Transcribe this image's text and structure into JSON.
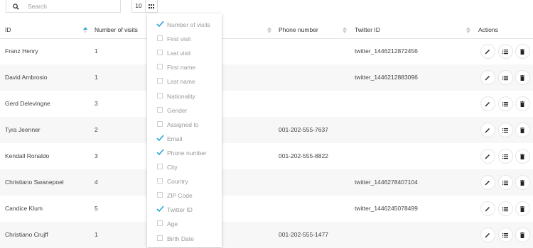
{
  "search": {
    "placeholder": "Search"
  },
  "page_size": "10",
  "table": {
    "columns": {
      "id": "ID",
      "visits": "Number of visits",
      "phone": "Phone number",
      "twitter": "Twitter ID",
      "actions": "Actions"
    },
    "rows": [
      {
        "id": "Franz Henry",
        "visits": "1",
        "phone": "",
        "twitter": "twitter_1446212872456"
      },
      {
        "id": "David Ambrosio",
        "visits": "1",
        "phone": "",
        "twitter": "twitter_1446212883096"
      },
      {
        "id": "Gerd Delevingne",
        "visits": "3",
        "phone": "",
        "twitter": ""
      },
      {
        "id": "Tyra Jeenner",
        "visits": "2",
        "phone": "001-202-555-7637",
        "twitter": ""
      },
      {
        "id": "Kendall Ronaldo",
        "visits": "3",
        "phone": "001-202-555-8822",
        "twitter": ""
      },
      {
        "id": "Christiano Swanepoel",
        "visits": "4",
        "phone": "",
        "twitter": "twitter_1446278407104"
      },
      {
        "id": "Candice Klum",
        "visits": "5",
        "phone": "",
        "twitter": "twitter_1446245078499"
      },
      {
        "id": "Christiano Crujff",
        "visits": "1",
        "phone": "001-202-555-1477",
        "twitter": ""
      }
    ]
  },
  "column_menu": [
    {
      "label": "Number of visits",
      "checked": true
    },
    {
      "label": "First visit",
      "checked": false
    },
    {
      "label": "Last visit",
      "checked": false
    },
    {
      "label": "First name",
      "checked": false
    },
    {
      "label": "Last name",
      "checked": false
    },
    {
      "label": "Nationality",
      "checked": false
    },
    {
      "label": "Gender",
      "checked": false
    },
    {
      "label": "Assigned to",
      "checked": false
    },
    {
      "label": "Email",
      "checked": true
    },
    {
      "label": "Phone number",
      "checked": true
    },
    {
      "label": "City",
      "checked": false
    },
    {
      "label": "Country",
      "checked": false
    },
    {
      "label": "ZIP Code",
      "checked": false
    },
    {
      "label": "Twitter ID",
      "checked": true
    },
    {
      "label": "Age",
      "checked": false
    },
    {
      "label": "Birth Date",
      "checked": false
    }
  ],
  "colors": {
    "accent": "#29a6d8",
    "row_alt": "#f7f7f7",
    "menu_text": "#999999"
  }
}
